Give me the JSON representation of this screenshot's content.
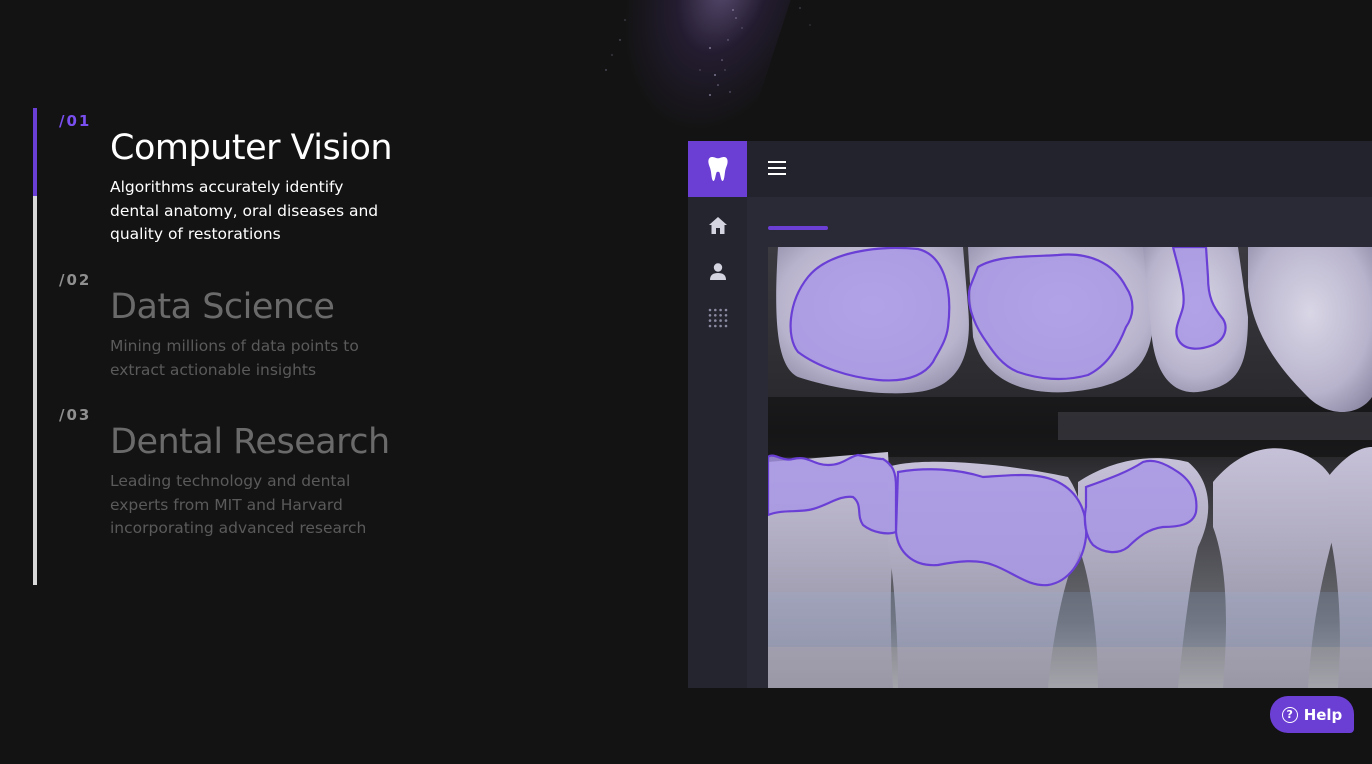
{
  "sections": [
    {
      "number": "/01",
      "title": "Computer Vision",
      "description": "Algorithms accurately identify dental anatomy, oral diseases and quality of restorations",
      "active": true
    },
    {
      "number": "/02",
      "title": "Data Science",
      "description": "Mining millions of data points to extract actionable insights",
      "active": false
    },
    {
      "number": "/03",
      "title": "Dental Research",
      "description": "Leading technology and dental experts from MIT and Harvard incorporating advanced research",
      "active": false
    }
  ],
  "progress": 0.185,
  "app": {
    "logo_icon": "tooth-icon",
    "menu_icon": "hamburger-menu-icon",
    "nav_icons": [
      "home-icon",
      "user-icon",
      "grid-icon"
    ],
    "image": "dental-xray-with-segmentation"
  },
  "help": {
    "label": "Help",
    "icon": "question-circle-icon"
  },
  "colors": {
    "accent": "#6b3ed4",
    "background": "#131313",
    "active_text": "#ffffff",
    "inactive_text": "#6a6a6a"
  }
}
